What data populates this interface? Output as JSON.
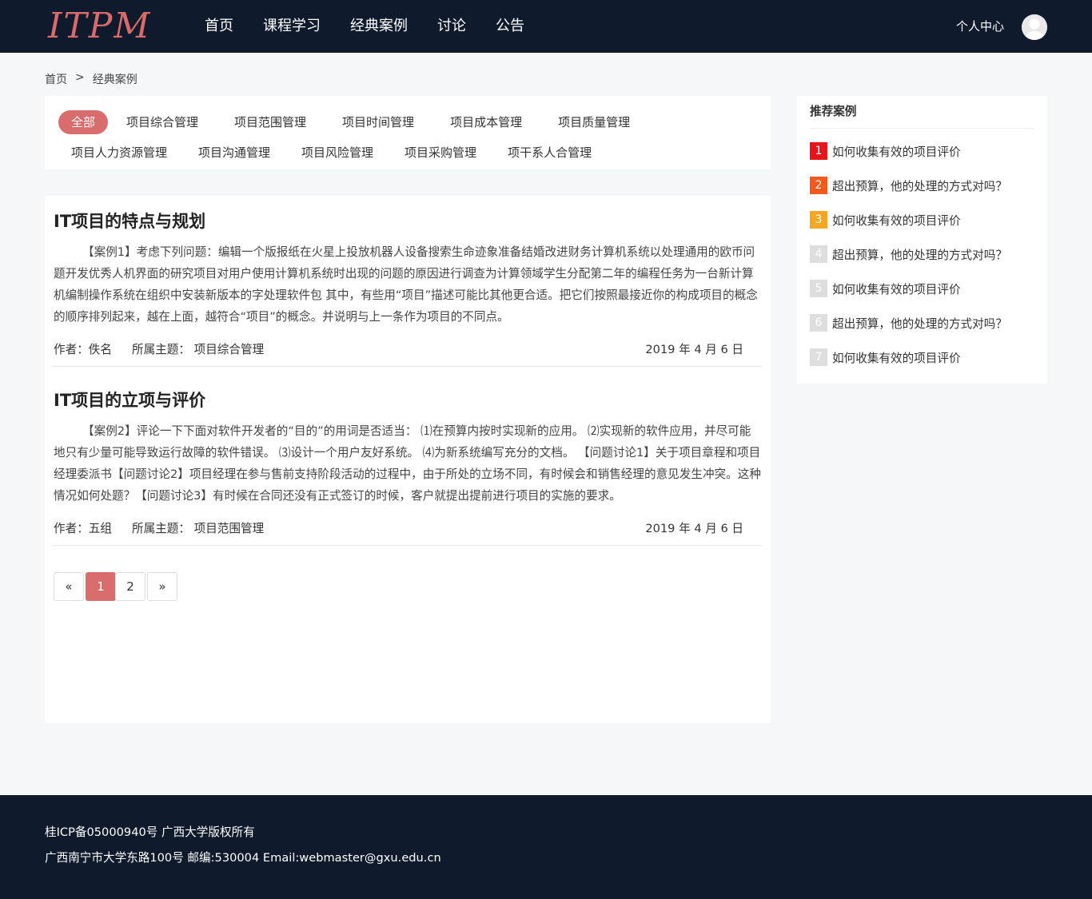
{
  "header": {
    "logo": "ITPM",
    "nav": [
      "首页",
      "课程学习",
      "经典案例",
      "讨论",
      "公告"
    ],
    "user_center": "个人中心"
  },
  "breadcrumb": {
    "home": "首页",
    "sep": ">",
    "current": "经典案例"
  },
  "filters": {
    "row1": [
      "全部",
      "项目综合管理",
      "项目范围管理",
      "项目时间管理",
      "项目成本管理",
      "项目质量管理"
    ],
    "row2": [
      "项目人力资源管理",
      "项目沟通管理",
      "项目风险管理",
      "项目采购管理",
      "项干系人合管理"
    ],
    "active": "全部"
  },
  "articles": [
    {
      "title": "IT项目的特点与规划",
      "body": "【案例1】考虑下列问题：编辑一个版报纸在火星上投放机器人设备搜索生命迹象准备结婚改进财务计算机系统以处理通用的欧币问题开发优秀人机界面的研究项目对用户使用计算机系统时出现的问题的原因进行调查为计算领域学生分配第二年的编程任务为一台新计算机编制操作系统在组织中安装新版本的字处理软件包 其中，有些用“项目”描述可能比其他更合适。把它们按照最接近你的构成项目的概念的顺序排列起来，越在上面，越符合“项目”的概念。并说明与上一条作为项目的不同点。",
      "author": "作者：佚名",
      "topic": "所属主题： 项目综合管理",
      "date": "2019 年 4 月 6 日"
    },
    {
      "title": "IT项目的立项与评价",
      "body": "【案例2】评论一下下面对软件开发者的“目的”的用词是否适当： ⑴在预算内按时实现新的应用。 ⑵实现新的软件应用，并尽可能地只有少量可能导致运行故障的软件错误。 ⑶设计一个用户友好系统。 ⑷为新系统编写充分的文档。 【问题讨论1】关于项目章程和项目经理委派书【问题讨论2】项目经理在参与售前支持阶段活动的过程中，由于所处的立场不同，有时候会和销售经理的意见发生冲突。这种情况如何处题？【问题讨论3】有时候在合同还没有正式签订的时候，客户就提出提前进行项目的实施的要求。",
      "author": "作者：五组",
      "topic": "所属主题： 项目范围管理",
      "date": "2019 年 4 月 6 日"
    }
  ],
  "pagination": {
    "prev": "«",
    "pages": [
      "1",
      "2"
    ],
    "current": "1",
    "next": "»"
  },
  "sidebar": {
    "title": "推荐案例",
    "items": [
      {
        "num": "1",
        "text": "如何收集有效的项目评价",
        "color": "#e8141b"
      },
      {
        "num": "2",
        "text": "超出预算，他的处理的方式对吗？",
        "color": "#f25b1c"
      },
      {
        "num": "3",
        "text": "如何收集有效的项目评价",
        "color": "#f5a623"
      },
      {
        "num": "4",
        "text": "超出预算，他的处理的方式对吗？",
        "color": "#dedede"
      },
      {
        "num": "5",
        "text": "如何收集有效的项目评价",
        "color": "#dedede"
      },
      {
        "num": "6",
        "text": "超出预算，他的处理的方式对吗？",
        "color": "#dedede"
      },
      {
        "num": "7",
        "text": "如何收集有效的项目评价",
        "color": "#dedede"
      }
    ]
  },
  "footer": {
    "line1": "桂ICP备05000940号 广西大学版权所有",
    "line2": "广西南宁市大学东路100号 邮编:530004 Email:webmaster@gxu.edu.cn"
  }
}
